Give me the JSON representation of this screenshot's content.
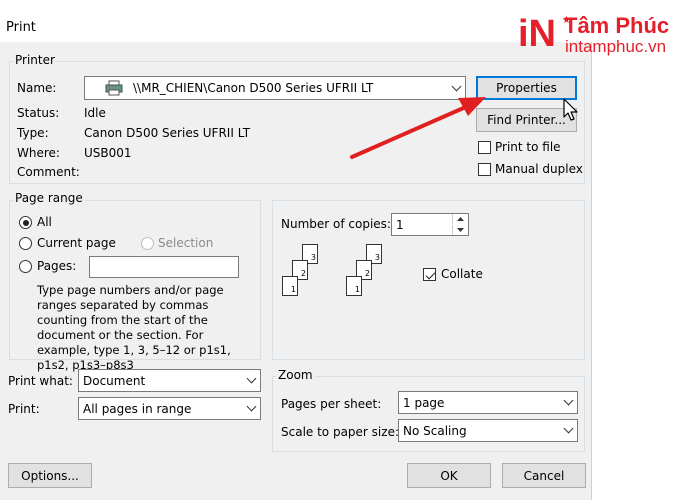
{
  "window": {
    "title": "Print"
  },
  "printer": {
    "group_label": "Printer",
    "name_label": "Name:",
    "name_value": "\\\\MR_CHIEN\\Canon D500 Series UFRII LT",
    "status_label": "Status:",
    "status_value": "Idle",
    "type_label": "Type:",
    "type_value": "Canon D500 Series UFRII LT",
    "where_label": "Where:",
    "where_value": "USB001",
    "comment_label": "Comment:",
    "properties_label": "Properties",
    "find_printer_label": "Find Printer...",
    "print_to_file_label": "Print to file",
    "manual_duplex_label": "Manual duplex",
    "print_to_file_checked": false,
    "manual_duplex_checked": false
  },
  "page_range": {
    "group_label": "Page range",
    "all_label": "All",
    "current_page_label": "Current page",
    "selection_label": "Selection",
    "pages_label": "Pages:",
    "pages_value": "",
    "help_text": "Type page numbers and/or page ranges separated by commas counting from the start of the document or the section. For example, type 1, 3, 5–12 or p1s1, p1s2, p1s3–p8s3",
    "selected": "All"
  },
  "copies": {
    "number_label": "Number of copies:",
    "number_value": "1",
    "collate_label": "Collate",
    "collate_checked": true,
    "stack_pages": [
      "1",
      "2",
      "3"
    ]
  },
  "print_what": {
    "label": "Print what:",
    "value": "Document"
  },
  "print": {
    "label": "Print:",
    "value": "All pages in range"
  },
  "zoom": {
    "group_label": "Zoom",
    "pages_per_sheet_label": "Pages per sheet:",
    "pages_per_sheet_value": "1 page",
    "scale_label": "Scale to paper size:",
    "scale_value": "No Scaling"
  },
  "footer": {
    "options_label": "Options...",
    "ok_label": "OK",
    "cancel_label": "Cancel"
  },
  "watermark": {
    "brand_in": "iN",
    "brand_name": "Tâm Phúc",
    "brand_url": "intamphuc.vn"
  },
  "colors": {
    "accent": "#0078d7",
    "annotation_arrow": "#e02020",
    "brand_red": "#e5202a"
  }
}
